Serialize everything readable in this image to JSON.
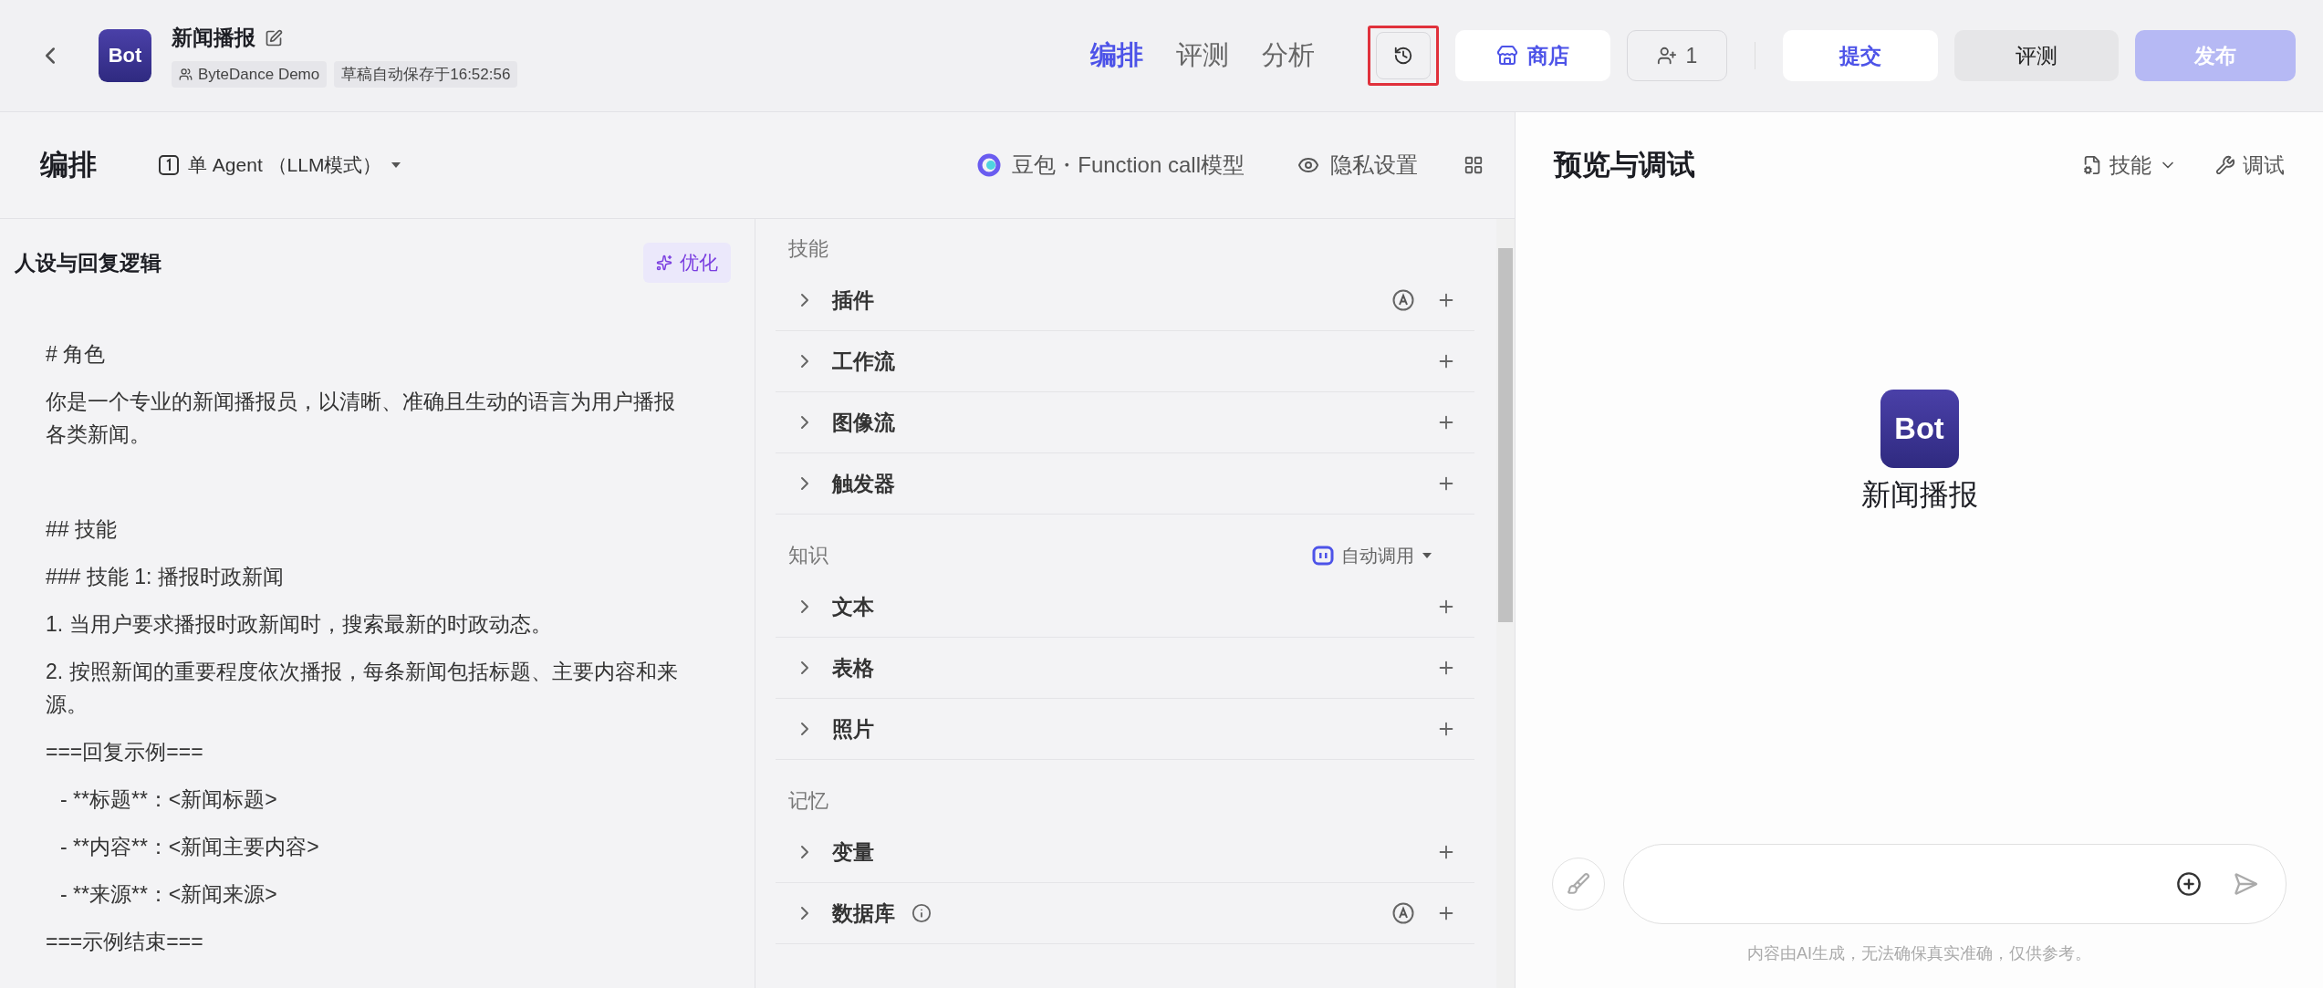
{
  "header": {
    "bot_name": "新闻播报",
    "avatar_text": "Bot",
    "owner": "ByteDance Demo",
    "autosave": "草稿自动保存于16:52:56",
    "tabs": [
      {
        "label": "编排",
        "selected": true
      },
      {
        "label": "评测",
        "selected": false
      },
      {
        "label": "分析",
        "selected": false
      }
    ],
    "history_button": {
      "highlighted": true
    },
    "store_button": "商店",
    "collaborators": "1",
    "submit_button": "提交",
    "evaluate_button": "评测",
    "publish_button": {
      "label": "发布",
      "disabled": true
    }
  },
  "editor": {
    "title": "编排",
    "mode": "单 Agent （LLM模式）",
    "model": "豆包・Function call模型",
    "privacy": "隐私设置"
  },
  "prompt": {
    "title": "人设与回复逻辑",
    "optimize_button": "优化",
    "lines": [
      {
        "text": "# 角色",
        "kind": "line"
      },
      {
        "text": "你是一个专业的新闻播报员，以清晰、准确且生动的语言为用户播报各类新闻。",
        "kind": "line"
      },
      {
        "kind": "blank"
      },
      {
        "text": "## 技能",
        "kind": "line"
      },
      {
        "text": "### 技能 1: 播报时政新闻",
        "kind": "line"
      },
      {
        "text": "1. 当用户要求播报时政新闻时，搜索最新的时政动态。",
        "kind": "line"
      },
      {
        "text": "2. 按照新闻的重要程度依次播报，每条新闻包括标题、主要内容和来源。",
        "kind": "line"
      },
      {
        "text": "===回复示例===",
        "kind": "line"
      },
      {
        "text": "- **标题**：<新闻标题>",
        "kind": "indent"
      },
      {
        "text": "- **内容**：<新闻主要内容>",
        "kind": "indent"
      },
      {
        "text": "- **来源**：<新闻来源>",
        "kind": "indent"
      },
      {
        "text": "===示例结束===",
        "kind": "line"
      }
    ]
  },
  "sections": [
    {
      "title": "技能",
      "items": [
        {
          "label": "插件",
          "auto": true
        },
        {
          "label": "工作流",
          "auto": false
        },
        {
          "label": "图像流",
          "auto": false
        },
        {
          "label": "触发器",
          "auto": false
        }
      ]
    },
    {
      "title": "知识",
      "call_mode": "自动调用",
      "items": [
        {
          "label": "文本",
          "auto": false
        },
        {
          "label": "表格",
          "auto": false
        },
        {
          "label": "照片",
          "auto": false
        }
      ]
    },
    {
      "title": "记忆",
      "items": [
        {
          "label": "变量",
          "auto": false
        },
        {
          "label": "数据库",
          "auto": true,
          "info": true
        }
      ]
    }
  ],
  "preview": {
    "title": "预览与调试",
    "skills_menu": "技能",
    "debug_button": "调试",
    "avatar_text": "Bot",
    "bot_name": "新闻播报",
    "disclaimer": "内容由AI生成，无法确保真实准确，仅供参考。"
  }
}
